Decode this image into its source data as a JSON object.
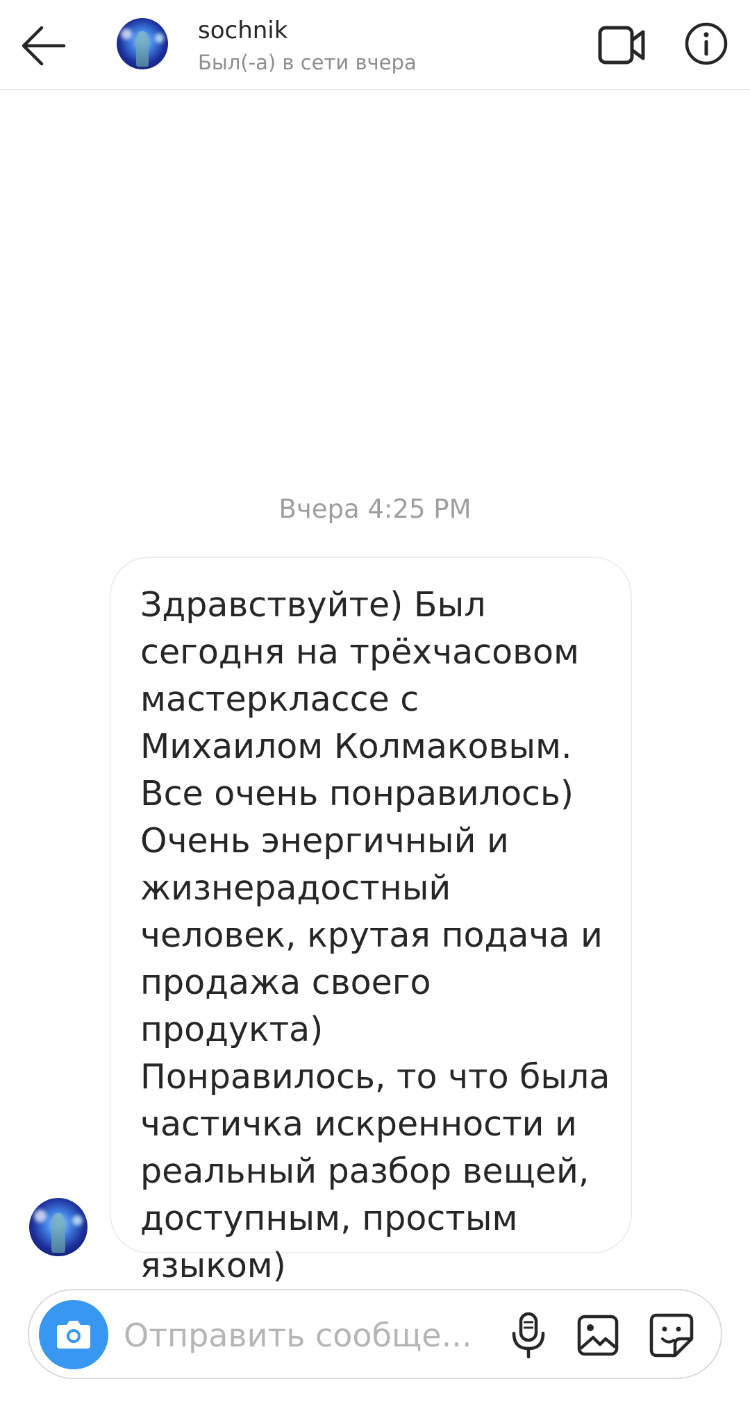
{
  "header": {
    "username": "sochnik",
    "status": "Был(-а) в сети вчера",
    "back_icon": "arrow-left-icon",
    "video_icon": "video-camera-icon",
    "info_icon": "info-circle-icon"
  },
  "conversation": {
    "timestamp": "Вчера 4:25 PM",
    "messages": [
      {
        "sender": "sochnik",
        "text": "Здравствуйте) Был сегодня на трёхчасовом мастерклассе с Михаилом Колмаковым.\nВсе очень понравилось)\nОчень энергичный и жизнерадостный человек, крутая подача и продажа своего продукта)\nПонравилось, то что была частичка искренности и реальный разбор вещей, доступным, простым языком)"
      }
    ]
  },
  "composer": {
    "placeholder": "Отправить сообще...",
    "value": "",
    "camera_icon": "camera-icon",
    "mic_icon": "microphone-icon",
    "gallery_icon": "image-gallery-icon",
    "sticker_icon": "sticker-icon"
  },
  "colors": {
    "accent": "#3897f0",
    "text_primary": "#262626",
    "text_secondary": "#8e8e8e",
    "border": "#dbdbdb"
  }
}
